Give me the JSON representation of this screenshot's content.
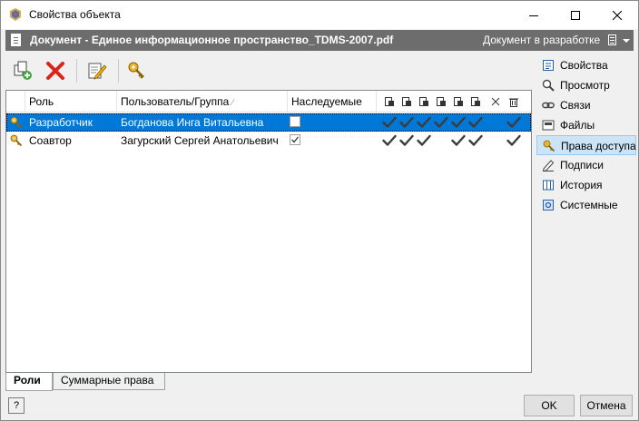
{
  "window": {
    "title": "Свойства объекта"
  },
  "doc": {
    "title": "Документ - Единое информационное пространство_TDMS-2007.pdf",
    "status": "Документ в разработке"
  },
  "toolbar": {
    "icons": [
      "add-role-icon",
      "delete-icon",
      "edit-icon",
      "key-icon"
    ]
  },
  "table": {
    "columns": {
      "role": "Роль",
      "user": "Пользователь/Группа",
      "inherited": "Наследуемые"
    },
    "rows": [
      {
        "role": "Разработчик",
        "user": "Богданова Инга Витальевна",
        "inherited": false,
        "selected": true,
        "perms": [
          true,
          true,
          true,
          true,
          true,
          true,
          false,
          true
        ]
      },
      {
        "role": "Соавтор",
        "user": "Загурский Сергей Анатольевич",
        "inherited": true,
        "selected": false,
        "perms": [
          true,
          true,
          true,
          false,
          true,
          true,
          false,
          true
        ]
      }
    ]
  },
  "tabs": [
    {
      "label": "Роли",
      "active": true
    },
    {
      "label": "Суммарные права",
      "active": false
    }
  ],
  "sidebar": {
    "items": [
      {
        "label": "Свойства",
        "icon": "properties-icon",
        "active": false
      },
      {
        "label": "Просмотр",
        "icon": "magnifier-icon",
        "active": false
      },
      {
        "label": "Связи",
        "icon": "links-icon",
        "active": false
      },
      {
        "label": "Файлы",
        "icon": "files-icon",
        "active": false
      },
      {
        "label": "Права доступа",
        "icon": "access-key-icon",
        "active": true
      },
      {
        "label": "Подписи",
        "icon": "signature-icon",
        "active": false
      },
      {
        "label": "История",
        "icon": "history-icon",
        "active": false
      },
      {
        "label": "Системные",
        "icon": "system-icon",
        "active": false
      }
    ]
  },
  "footer": {
    "help": "?",
    "ok": "OK",
    "cancel": "Отмена"
  }
}
